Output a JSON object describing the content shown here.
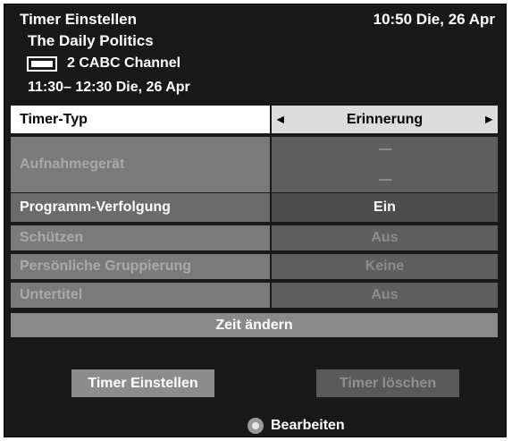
{
  "header": {
    "title": "Timer Einstellen",
    "clock": "10:50 Die, 26 Apr",
    "programme": "The Daily Politics",
    "channel": "2 CABC Channel",
    "time_range": "11:30– 12:30 Die, 26 Apr"
  },
  "rows": {
    "timer_type": {
      "label": "Timer-Typ",
      "value": "Erinnerung"
    },
    "recorder": {
      "label": "Aufnahmegerät"
    },
    "tracking": {
      "label": "Programm-Verfolgung",
      "value": "Ein"
    },
    "protect": {
      "label": "Schützen",
      "value": "Aus"
    },
    "grouping": {
      "label": "Persönliche Gruppierung",
      "value": "Keine"
    },
    "subtitles": {
      "label": "Untertitel",
      "value": "Aus"
    }
  },
  "buttons": {
    "change_time": "Zeit ändern",
    "set_timer": "Timer Einstellen",
    "delete_timer": "Timer löschen"
  },
  "footer": {
    "hint": "Bearbeiten"
  }
}
